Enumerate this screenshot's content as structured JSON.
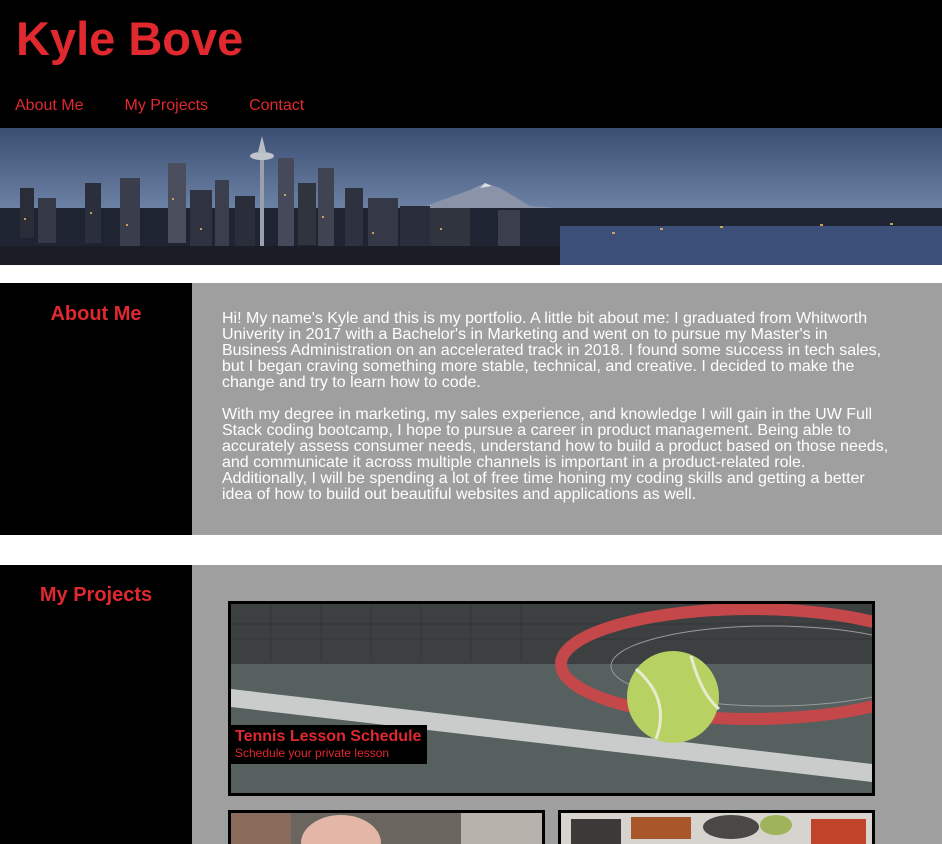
{
  "header": {
    "title": "Kyle Bove",
    "nav": [
      {
        "label": "About Me"
      },
      {
        "label": "My Projects"
      },
      {
        "label": "Contact"
      }
    ]
  },
  "about": {
    "heading": "About Me",
    "paragraphs": [
      "Hi! My name's Kyle and this is my portfolio. A little bit about me: I graduated from Whitworth Univerity in 2017 with a Bachelor's in Marketing and went on to pursue my Master's in Business Administration on an accelerated track in 2018. I found some success in tech sales, but I began craving something more stable, technical, and creative. I decided to make the change and try to learn how to code.",
      "With my degree in marketing, my sales experience, and knowledge I will gain in the UW Full Stack coding bootcamp, I hope to pursue a career in product management. Being able to accurately assess consumer needs, understand how to build a product based on those needs, and communicate it across multiple channels is important in a product-related role. Additionally, I will be spending a lot of free time honing my coding skills and getting a better idea of how to build out beautiful websites and applications as well."
    ]
  },
  "projects": {
    "heading": "My Projects",
    "featured": {
      "title": "Tennis Lesson Schedule",
      "subtitle": "Schedule your private lesson"
    }
  },
  "colors": {
    "accent": "#e0282f",
    "header_bg": "#000000",
    "panel_bg": "#a09f9f"
  }
}
